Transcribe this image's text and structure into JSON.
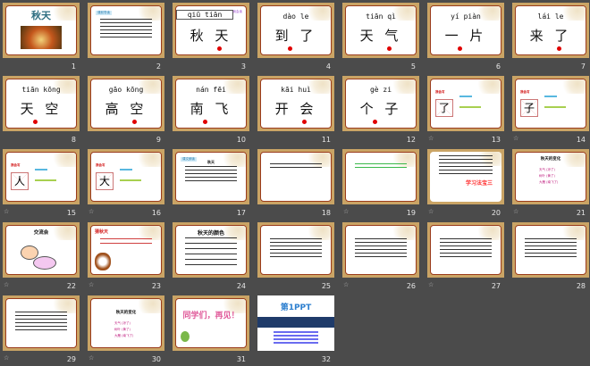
{
  "app": "Slide Sorter",
  "colors": {
    "background": "#4b4b4b",
    "frame": "#caa465",
    "border": "#9a3b1c",
    "accent_red": "#e00000"
  },
  "slides": [
    {
      "n": "1",
      "type": "title",
      "title": "秋天"
    },
    {
      "n": "2",
      "type": "text",
      "tag": "课前导读"
    },
    {
      "n": "3",
      "type": "word",
      "pinyin": "qiū tiān",
      "chars": "秋 天",
      "boxed": true,
      "corner_text": "我会读"
    },
    {
      "n": "4",
      "type": "word",
      "pinyin": "dào le",
      "chars": "到 了"
    },
    {
      "n": "5",
      "type": "word",
      "pinyin": "tiān qì",
      "chars": "天 气"
    },
    {
      "n": "6",
      "type": "word",
      "pinyin": "yí  piàn",
      "chars": "一 片"
    },
    {
      "n": "7",
      "type": "word",
      "pinyin": "lái le",
      "chars": "来 了"
    },
    {
      "n": "8",
      "type": "word",
      "pinyin": "tiān kōng",
      "chars": "天 空"
    },
    {
      "n": "9",
      "type": "word",
      "pinyin": "gāo kōng",
      "chars": "高 空"
    },
    {
      "n": "10",
      "type": "word",
      "pinyin": "nán fēi",
      "chars": "南 飞"
    },
    {
      "n": "11",
      "type": "word",
      "pinyin": "kāi huì",
      "chars": "开 会"
    },
    {
      "n": "12",
      "type": "word",
      "pinyin": "gè  zi",
      "chars": "个 子"
    },
    {
      "n": "13",
      "type": "write",
      "label": "我会写",
      "char": "了",
      "anim": true
    },
    {
      "n": "14",
      "type": "write",
      "label": "我会写",
      "char": "子",
      "anim": true
    },
    {
      "n": "15",
      "type": "write",
      "label": "我会写",
      "char": "人",
      "anim": true
    },
    {
      "n": "16",
      "type": "write",
      "label": "我会写",
      "char": "大",
      "anim": true
    },
    {
      "n": "17",
      "type": "text",
      "heading": "秋天",
      "tag": "课文朗读"
    },
    {
      "n": "18",
      "type": "text"
    },
    {
      "n": "19",
      "type": "text",
      "anim": true
    },
    {
      "n": "20",
      "type": "method",
      "highlight": "学习法宝三",
      "anim": true
    },
    {
      "n": "21",
      "type": "change",
      "heading": "秋天的变化",
      "items": [
        "天气 (凉了)",
        "树叶 (黄了)",
        "大雁 (南飞了)"
      ],
      "anim": true
    },
    {
      "n": "22",
      "type": "heading",
      "heading": "交流会",
      "anim": true
    },
    {
      "n": "23",
      "type": "heading",
      "heading": "猜秋天",
      "anim": true
    },
    {
      "n": "24",
      "type": "heading",
      "heading": "秋天的颜色"
    },
    {
      "n": "25",
      "type": "text"
    },
    {
      "n": "26",
      "type": "text",
      "anim": true
    },
    {
      "n": "27",
      "type": "text",
      "anim": true
    },
    {
      "n": "28",
      "type": "text"
    },
    {
      "n": "29",
      "type": "text",
      "anim": true
    },
    {
      "n": "30",
      "type": "change",
      "heading": "秋天的变化",
      "items": [
        "天气 (凉了)",
        "树叶 (黄了)",
        "大雁 (南飞了)"
      ],
      "anim": true,
      "framed": true
    },
    {
      "n": "31",
      "type": "bye",
      "text": "同学们，再见！"
    },
    {
      "n": "32",
      "type": "brand",
      "text": "第1PPT"
    }
  ]
}
